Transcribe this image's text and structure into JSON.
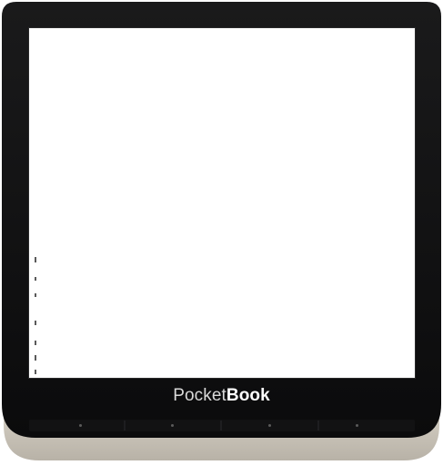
{
  "device": {
    "brand_light": "Pocket",
    "brand_bold": "Book",
    "colors": {
      "bezel": "#0e0e0f",
      "frame": "#c9c3b8",
      "screen": "#ffffff"
    }
  },
  "buttons": [
    {
      "name": "prev-page-button",
      "icon": "dot"
    },
    {
      "name": "next-page-button",
      "icon": "dot"
    },
    {
      "name": "home-button",
      "icon": "dot"
    },
    {
      "name": "menu-button",
      "icon": "dot"
    }
  ]
}
